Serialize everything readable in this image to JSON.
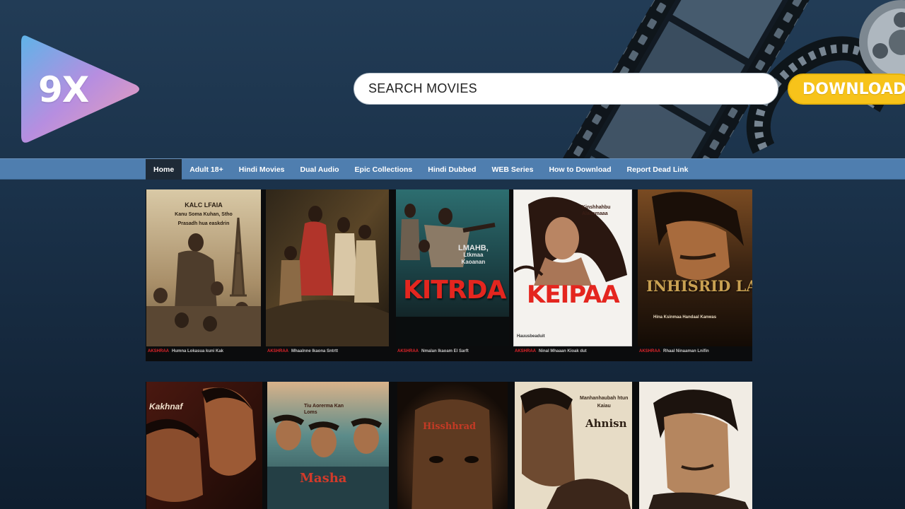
{
  "brand": {
    "logo_text": "9X",
    "logo_gradient": [
      "#5fb3e8",
      "#b68ee0",
      "#f0a0b4"
    ]
  },
  "search": {
    "placeholder": "SEARCH MOVIES",
    "value": ""
  },
  "download_button": {
    "label": "DOWNLOAD",
    "color": "#f7c31a"
  },
  "nav": {
    "color": "#4f7eaf",
    "items": [
      {
        "label": "Home",
        "active": true
      },
      {
        "label": "Adult 18+"
      },
      {
        "label": "Hindi Movies"
      },
      {
        "label": "Dual Audio"
      },
      {
        "label": "Epic Collections"
      },
      {
        "label": "Hindi Dubbed"
      },
      {
        "label": "WEB Series"
      },
      {
        "label": "How to Download"
      },
      {
        "label": "Report Dead Link"
      }
    ]
  },
  "movies_row1": [
    {
      "poster_lines": [
        "KALC LFAIA",
        "Kanu Soma Kuhan, Stho",
        "Prasadh hua easkdrin"
      ],
      "caption_tag": "AKSHRAA",
      "caption": "Humna Lokasua kuni Kak"
    },
    {
      "caption_tag": "AKSHRAA",
      "caption": "Mhaalnne Ikaona Sntrtt"
    },
    {
      "poster_lines": [
        "LMAHB,",
        "Ltkmaa",
        "Kaoanan"
      ],
      "title": "KITRDA",
      "caption_tag": "AKSHRAA",
      "caption": "Nmalan Ikaoam El Sarft"
    },
    {
      "poster_lines": [
        "Kinshhahbu",
        "Alasamaaa"
      ],
      "title": "KEIPAA",
      "poster_footer": "Hauusbeaduit",
      "caption_tag": "AKSHRAA",
      "caption": "Ninal Mhaaan Kioak dut"
    },
    {
      "title": "INHISRID LANSHIDA",
      "subtitle": "Hina Ksinmaa Handaal Kanwas",
      "caption_tag": "AKSHRAA",
      "caption": "Rhaal Ninaaman Lnifin"
    }
  ],
  "movies_row2": [
    {
      "poster_lines": [
        "Kakhnaf"
      ]
    },
    {
      "poster_lines": [
        "Tiu Aorerma Kan",
        "Loms"
      ],
      "title": "Masha"
    },
    {
      "title": "Hisshhrad"
    },
    {
      "poster_lines": [
        "Manhanhaubah htun",
        "Kaiau"
      ],
      "title": "Ahnisn"
    },
    {}
  ]
}
